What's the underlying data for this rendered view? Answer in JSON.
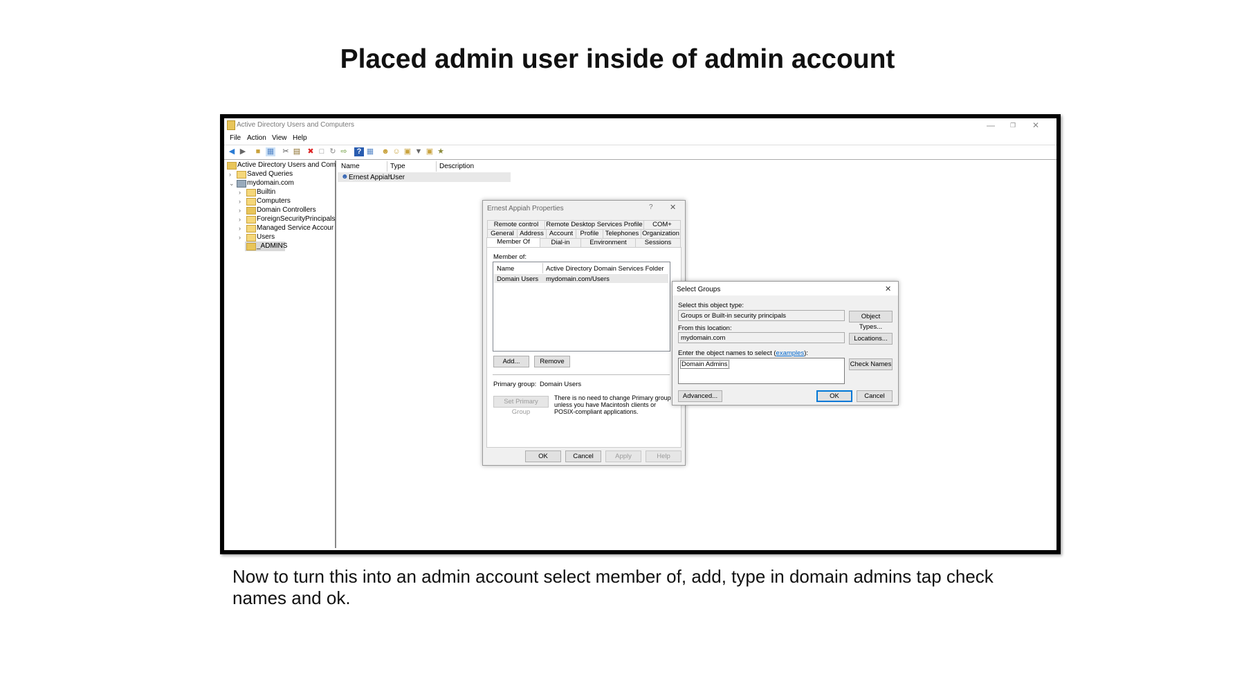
{
  "slide": {
    "title": "Placed admin user inside of admin account",
    "caption": "Now to turn this into an admin account select member of, add, type in domain admins tap check names and ok."
  },
  "window": {
    "title": "Active Directory Users and Computers",
    "controls": {
      "minimize": "—",
      "restore": "❐",
      "close": "✕"
    },
    "menu": [
      "File",
      "Action",
      "View",
      "Help"
    ]
  },
  "tree": {
    "root": "Active Directory Users and Com",
    "saved_queries": "Saved Queries",
    "domain": "mydomain.com",
    "children": [
      "Builtin",
      "Computers",
      "Domain Controllers",
      "ForeignSecurityPrincipals",
      "Managed Service Accour",
      "Users",
      "_ADMINS"
    ]
  },
  "list": {
    "columns": [
      "Name",
      "Type",
      "Description"
    ],
    "rows": [
      {
        "name": "Ernest Appiah",
        "type": "User",
        "description": ""
      }
    ]
  },
  "properties_dialog": {
    "title": "Ernest Appiah Properties",
    "help": "?",
    "close": "✕",
    "tabs_row1": [
      "Remote control",
      "Remote Desktop Services Profile",
      "COM+"
    ],
    "tabs_row2": [
      "General",
      "Address",
      "Account",
      "Profile",
      "Telephones",
      "Organization"
    ],
    "tabs_row3": [
      "Member Of",
      "Dial-in",
      "Environment",
      "Sessions"
    ],
    "member_of_label": "Member of:",
    "table_headers": [
      "Name",
      "Active Directory Domain Services Folder"
    ],
    "table_rows": [
      {
        "name": "Domain Users",
        "folder": "mydomain.com/Users"
      }
    ],
    "add": "Add...",
    "remove": "Remove",
    "primary_group_label": "Primary group:",
    "primary_group_value": "Domain Users",
    "set_primary": "Set Primary Group",
    "note": "There is no need to change Primary group unless you have Macintosh clients or POSIX-compliant applications.",
    "ok": "OK",
    "cancel": "Cancel",
    "apply": "Apply",
    "help_btn": "Help"
  },
  "select_groups": {
    "title": "Select Groups",
    "close": "✕",
    "object_type_label": "Select this object type:",
    "object_type_value": "Groups or Built-in security principals",
    "object_types_btn": "Object Types...",
    "location_label": "From this location:",
    "location_value": "mydomain.com",
    "locations_btn": "Locations...",
    "enter_label": "Enter the object names to select (",
    "examples_link": "examples",
    "enter_label_end": "):",
    "names_value": "Domain Admins",
    "check_names_btn": "Check Names",
    "advanced_btn": "Advanced...",
    "ok": "OK",
    "cancel": "Cancel"
  },
  "colors": {
    "link": "#0066cc",
    "accent": "#0078d7",
    "folder": "#f5d77a"
  }
}
